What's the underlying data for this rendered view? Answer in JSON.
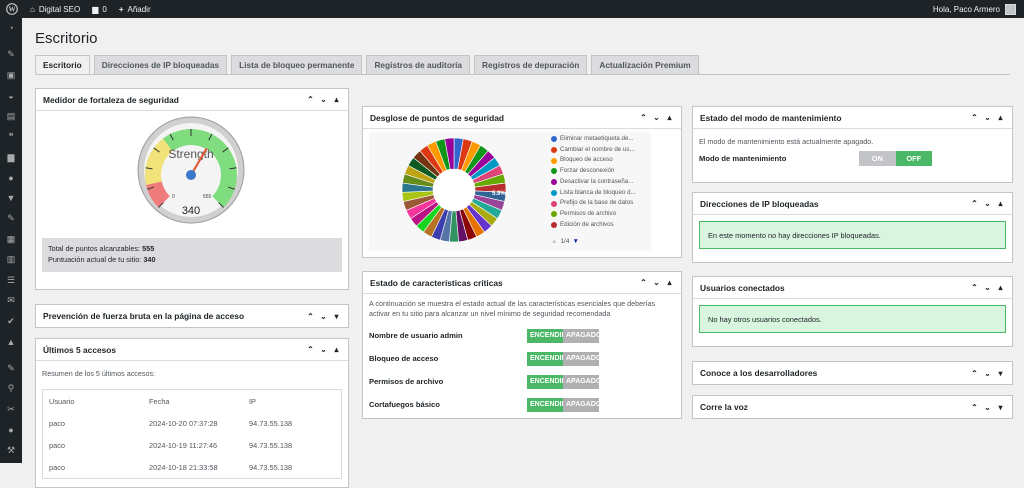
{
  "adminbar": {
    "site": "Digital SEO",
    "comments": "0",
    "add": "Añadir",
    "greeting": "Hola, Paco Armero"
  },
  "page_title": "Escritorio",
  "tabs": [
    "Escritorio",
    "Direcciones de IP bloqueadas",
    "Lista de bloqueo permanente",
    "Registros de auditoría",
    "Registros de depuración",
    "Actualización Premium"
  ],
  "strength": {
    "title": "Medidor de fortaleza de seguridad",
    "gauge_label": "Strength",
    "score": "340",
    "min": "0",
    "max": "555",
    "total_label": "Total de puntos alcanzables:",
    "total_value": "555",
    "current_label": "Puntuación actual de tu sitio:",
    "current_value": "340",
    "fraction": 0.613
  },
  "brute": {
    "title": "Prevención de fuerza bruta en la página de acceso"
  },
  "logins": {
    "title": "Últimos 5 accesos",
    "summary": "Resumen de los 5 últimos accesos:",
    "headers": [
      "Usuario",
      "Fecha",
      "IP"
    ],
    "rows": [
      [
        "paco",
        "2024-10-20 07:37:28",
        "94.73.55.138"
      ],
      [
        "paco",
        "2024-10-19 11:27:46",
        "94.73.55.138"
      ],
      [
        "paco",
        "2024-10-18 21:33:58",
        "94.73.55.138"
      ]
    ]
  },
  "breakdown": {
    "title": "Desglose de puntos de seguridad",
    "page": "1/4",
    "slice_label": "5.9%",
    "legend": [
      {
        "label": "Eliminar metaetiqueta de...",
        "color": "#3366cc"
      },
      {
        "label": "Cambiar el nombre de us...",
        "color": "#dc3912"
      },
      {
        "label": "Bloqueo de acceso",
        "color": "#ff9900"
      },
      {
        "label": "Forzar desconexión",
        "color": "#109618"
      },
      {
        "label": "Desactivar la contraseña...",
        "color": "#990099"
      },
      {
        "label": "Lista blanca de bloqueo d...",
        "color": "#0099c6"
      },
      {
        "label": "Prefijo de la base de datos",
        "color": "#dd4477"
      },
      {
        "label": "Permisos de archivo",
        "color": "#66aa00"
      },
      {
        "label": "Edición de archivos",
        "color": "#b82e2e"
      }
    ]
  },
  "critical": {
    "title": "Estado de características críticas",
    "desc": "A continuación se muestra el estado actual de las características esenciales que deberías activar en tu sitio para alcanzar un nivel mínimo de seguridad recomendada",
    "on": "ENCENDIDO",
    "off": "APAGADO",
    "features": [
      "Nombre de usuario admin",
      "Bloqueo de acceso",
      "Permisos de archivo",
      "Cortafuegos básico"
    ]
  },
  "maint": {
    "title": "Estado del modo de mantenimiento",
    "desc": "El modo de mantenimiento está actualmente apagado.",
    "label": "Modo de mantenimiento",
    "on": "ON",
    "off": "OFF"
  },
  "blocked": {
    "title": "Direcciones de IP bloqueadas",
    "msg": "En este momento no hay direcciones IP bloqueadas."
  },
  "users": {
    "title": "Usuarios conectados",
    "msg": "No hay otros usuarios conectados."
  },
  "devs": {
    "title": "Conoce a los desarrolladores"
  },
  "spread": {
    "title": "Corre la voz"
  }
}
